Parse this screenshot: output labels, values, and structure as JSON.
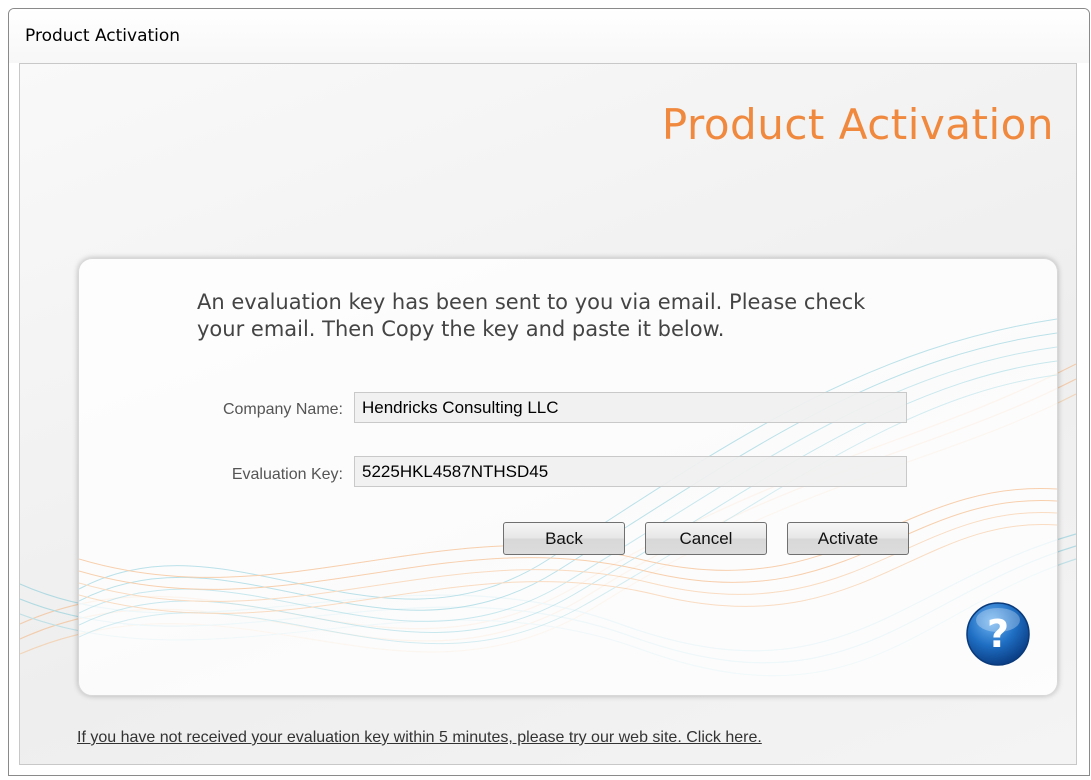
{
  "window": {
    "title": "Product Activation"
  },
  "header": {
    "title": "Product Activation"
  },
  "panel": {
    "instructions": "An evaluation key has been sent to you via email. Please check your email. Then Copy the key and paste it below.",
    "company": {
      "label": "Company Name:",
      "value": "Hendricks Consulting LLC"
    },
    "key": {
      "label": "Evaluation Key:",
      "value": "5225HKL4587NTHSD45"
    },
    "buttons": {
      "back": "Back",
      "cancel": "Cancel",
      "activate": "Activate"
    },
    "help_icon": "question-mark-icon"
  },
  "footer": {
    "link": "If you have not received your evaluation key within 5 minutes, please try our web site. Click here."
  },
  "colors": {
    "header_title": "#f0893e",
    "wave_blue": "#7fc9d8",
    "wave_orange": "#f5b27a",
    "help_blue": "#1f6fc4"
  }
}
